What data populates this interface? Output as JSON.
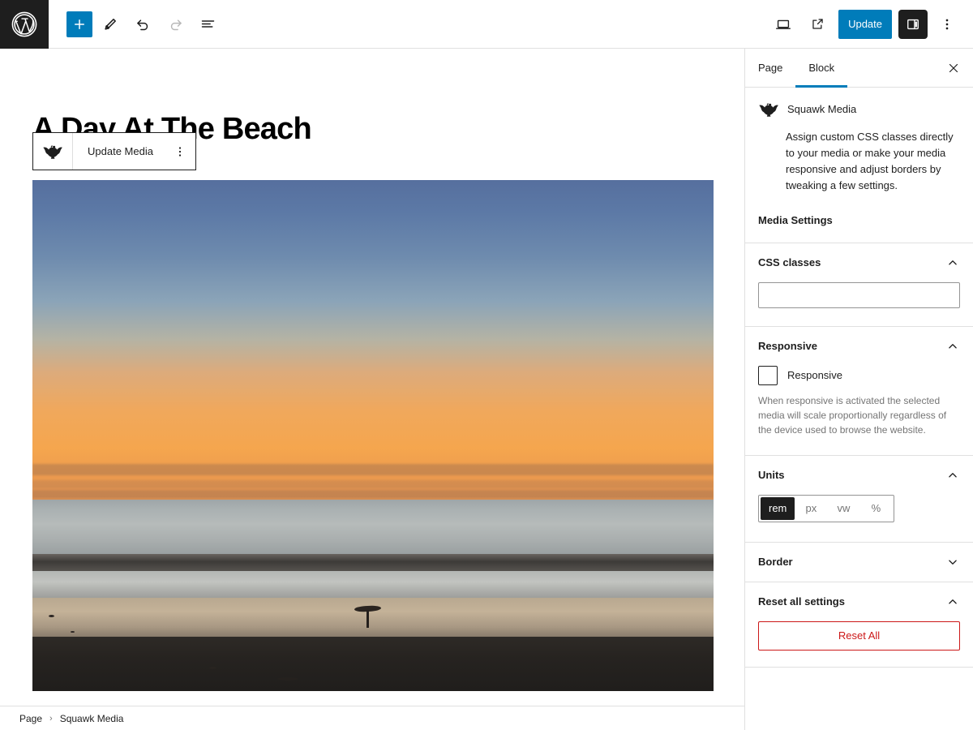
{
  "topbar": {
    "logo_icon": "wordpress-logo-icon",
    "left_tools": [
      {
        "name": "add-block-button",
        "icon": "plus-icon",
        "title": "Add block",
        "state": "primary"
      },
      {
        "name": "edit-tool-button",
        "icon": "pencil-icon",
        "title": "Tools",
        "state": "normal"
      },
      {
        "name": "undo-button",
        "icon": "undo-arrow-icon",
        "title": "Undo",
        "state": "normal"
      },
      {
        "name": "redo-button",
        "icon": "redo-arrow-icon",
        "title": "Redo",
        "state": "disabled"
      },
      {
        "name": "document-overview-button",
        "icon": "list-view-icon",
        "title": "Document Overview",
        "state": "normal"
      }
    ],
    "right_tools": [
      {
        "name": "preview-button",
        "icon": "desktop-icon",
        "title": "Preview",
        "state": "normal"
      },
      {
        "name": "view-page-button",
        "icon": "external-link-icon",
        "title": "View Page",
        "state": "normal"
      }
    ],
    "update_label": "Update",
    "settings_toggle": {
      "name": "settings-sidebar-toggle",
      "icon": "sidebar-panel-icon",
      "title": "Settings",
      "state": "pressed"
    },
    "options_button": {
      "name": "options-menu-button",
      "icon": "kebab-menu-icon",
      "title": "Options"
    },
    "accent_color": "#007cba"
  },
  "canvas": {
    "post_title": "A Day At The Beach",
    "block_toolbar": {
      "block_icon": "squawk-bird-icon",
      "action_label": "Update Media",
      "more_icon": "kebab-menu-icon"
    },
    "image_block": {
      "alt": "Beach at sunset with a surfer carrying a board",
      "sky_top_color": "#566f9e",
      "sky_bottom_color": "#f5a64e",
      "ocean_color": "#b6bbba",
      "sand_color": "#c4b298",
      "foreground_color": "#262320"
    }
  },
  "breadcrumb": {
    "items": [
      "Page",
      "Squawk Media"
    ],
    "separator": "›"
  },
  "sidebar": {
    "tabs": [
      {
        "label": "Page",
        "active": false
      },
      {
        "label": "Block",
        "active": true
      }
    ],
    "close_icon": "close-x-icon",
    "block": {
      "icon": "squawk-bird-icon",
      "name": "Squawk Media",
      "description": "Assign custom CSS classes directly to your media or make your media responsive and adjust borders by tweaking a few settings.",
      "settings_heading": "Media Settings"
    },
    "panels": [
      {
        "id": "css-classes",
        "title": "CSS classes",
        "expanded": true,
        "chevron": "chevron-up-icon",
        "input": {
          "name": "css-classes-input",
          "value": "",
          "placeholder": ""
        }
      },
      {
        "id": "responsive",
        "title": "Responsive",
        "expanded": true,
        "chevron": "chevron-up-icon",
        "checkbox": {
          "name": "responsive-checkbox",
          "label": "Responsive",
          "checked": false
        },
        "help": "When responsive is activated the selected media will scale proportionally regardless of the device used to browse the website."
      },
      {
        "id": "units",
        "title": "Units",
        "expanded": true,
        "chevron": "chevron-up-icon",
        "options": [
          "rem",
          "px",
          "vw",
          "%"
        ],
        "selected": "rem"
      },
      {
        "id": "border",
        "title": "Border",
        "expanded": false,
        "chevron": "chevron-down-icon"
      },
      {
        "id": "reset-all-settings",
        "title": "Reset all settings",
        "expanded": true,
        "chevron": "chevron-up-icon",
        "reset_label": "Reset All",
        "reset_color": "#cc1818"
      }
    ]
  }
}
